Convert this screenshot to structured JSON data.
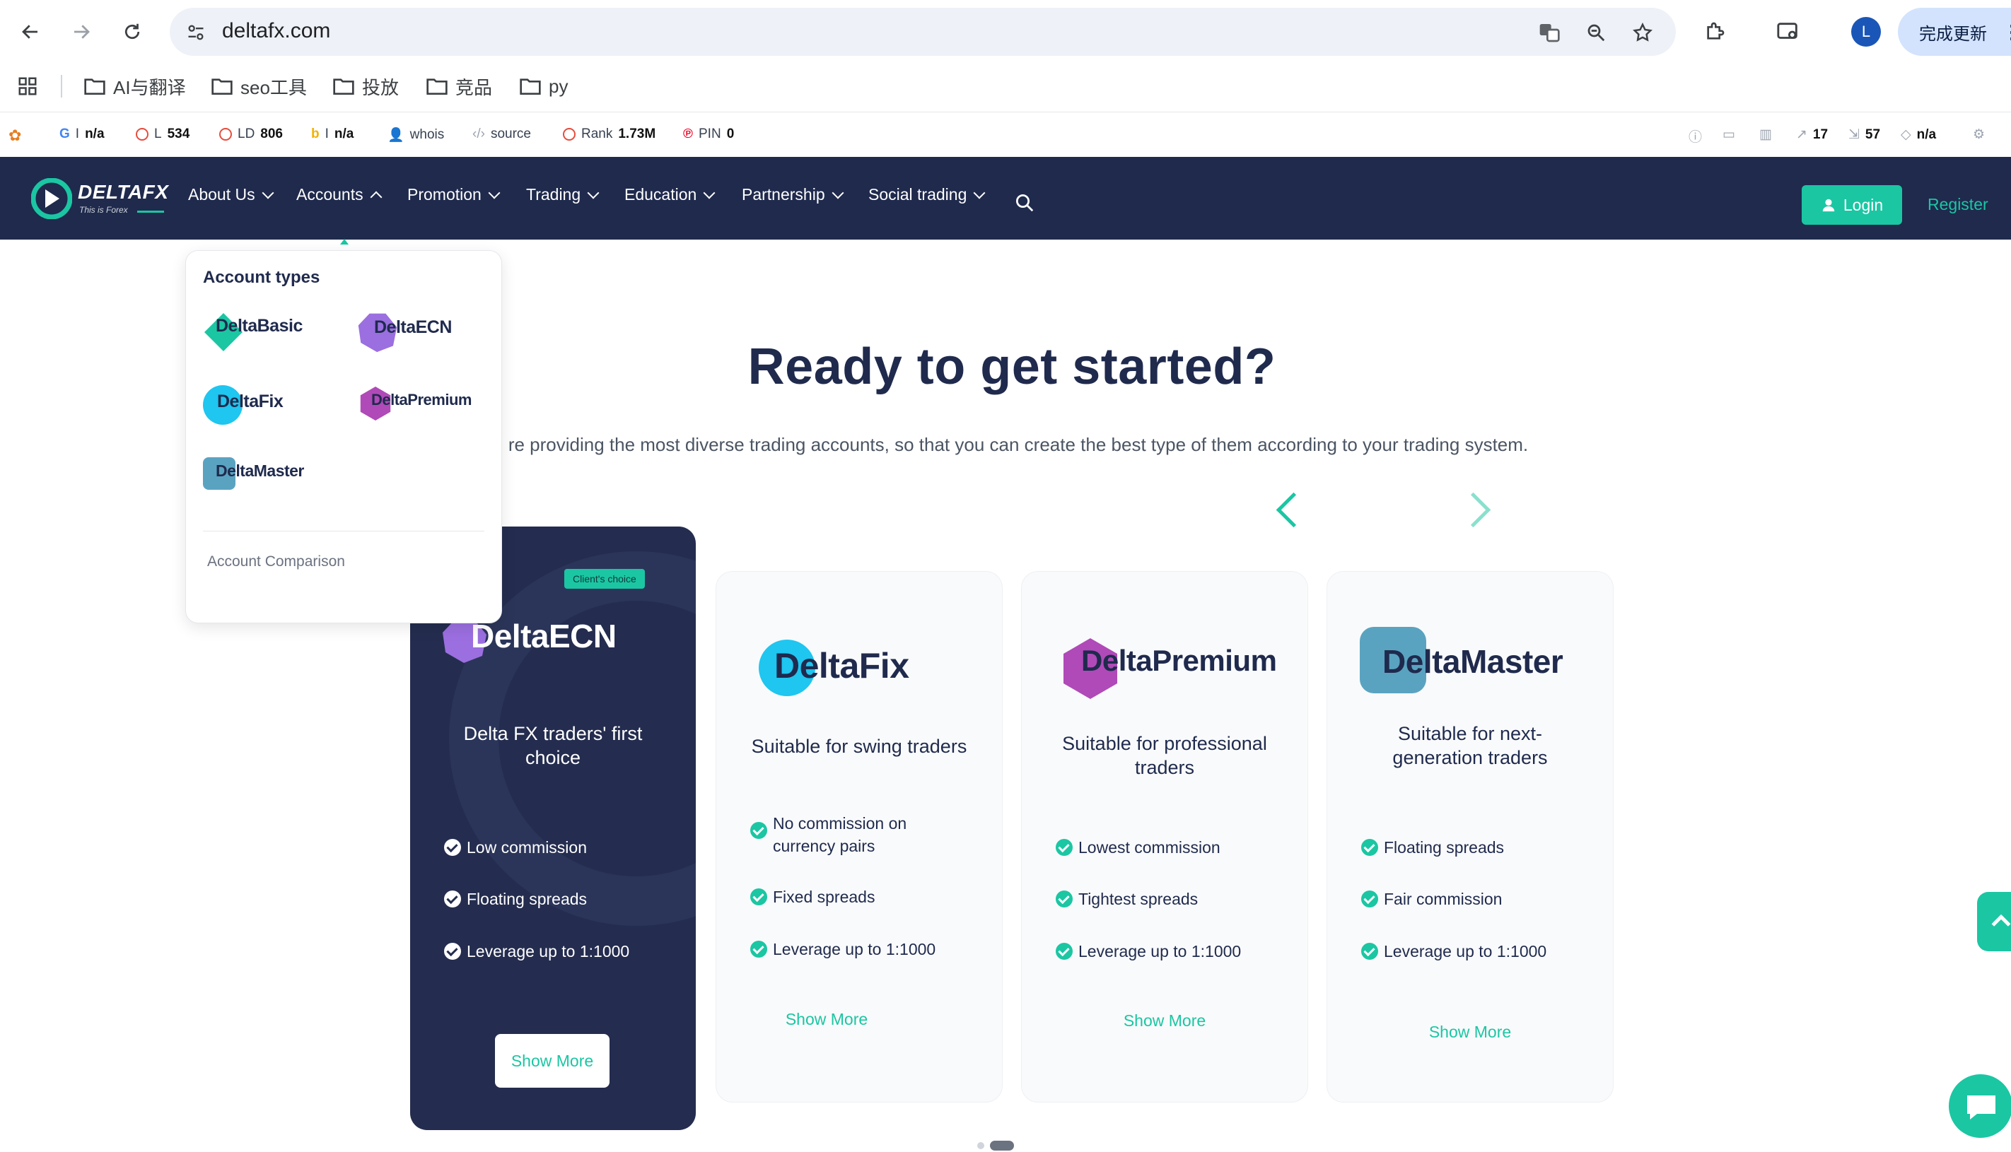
{
  "browser": {
    "url": "deltafx.com",
    "update_button": "完成更新",
    "profile_initial": "L",
    "bookmarks": [
      "AI与翻译",
      "seo工具",
      "投放",
      "竞品",
      "py"
    ]
  },
  "seo_bar": {
    "google": "n/a",
    "links": "534",
    "ld": "806",
    "bing": "n/a",
    "whois": "whois",
    "source": "source",
    "rank_label": "Rank",
    "rank": "1.73M",
    "pin_label": "PIN",
    "pin": "0",
    "ext_a": "17",
    "ext_b": "57",
    "ext_c": "n/a"
  },
  "header": {
    "brand": "DELTAFX",
    "tagline": "This is Forex",
    "menu": [
      "About Us",
      "Accounts",
      "Promotion",
      "Trading",
      "Education",
      "Partnership",
      "Social trading"
    ],
    "login": "Login",
    "register": "Register"
  },
  "dropdown": {
    "title": "Account types",
    "items": [
      "DeltaBasic",
      "DeltaECN",
      "DeltaFix",
      "DeltaPremium",
      "DeltaMaster"
    ],
    "comparison": "Account Comparison"
  },
  "hero": {
    "title": "Ready to get started?",
    "subtitle": "re providing the most diverse trading accounts, so that you can create the best type of them according to your trading system."
  },
  "cards": [
    {
      "name": "DeltaECN",
      "badge": "Client's choice",
      "desc": "Delta FX traders' first choice",
      "features": [
        "Low commission",
        "Floating spreads",
        "Leverage up to 1:1000"
      ],
      "cta": "Show More"
    },
    {
      "name": "DeltaFix",
      "desc": "Suitable for swing traders",
      "features": [
        "No commission on currency pairs",
        "Fixed spreads",
        "Leverage up to 1:1000"
      ],
      "cta": "Show More"
    },
    {
      "name": "DeltaPremium",
      "desc": "Suitable for professional traders",
      "features": [
        "Lowest commission",
        "Tightest spreads",
        "Leverage up to 1:1000"
      ],
      "cta": "Show More"
    },
    {
      "name": "DeltaMaster",
      "desc": "Suitable for next-generation traders",
      "features": [
        "Floating spreads",
        "Fair commission",
        "Leverage up to 1:1000"
      ],
      "cta": "Show More"
    }
  ],
  "colors": {
    "brand_dark": "#1f2a4d",
    "accent": "#1bc6a3",
    "basic": "#1bc6a3",
    "ecn": "#9b6fe0",
    "fix": "#1ec6f0",
    "premium": "#b04ab8",
    "master": "#5aa3c0"
  }
}
